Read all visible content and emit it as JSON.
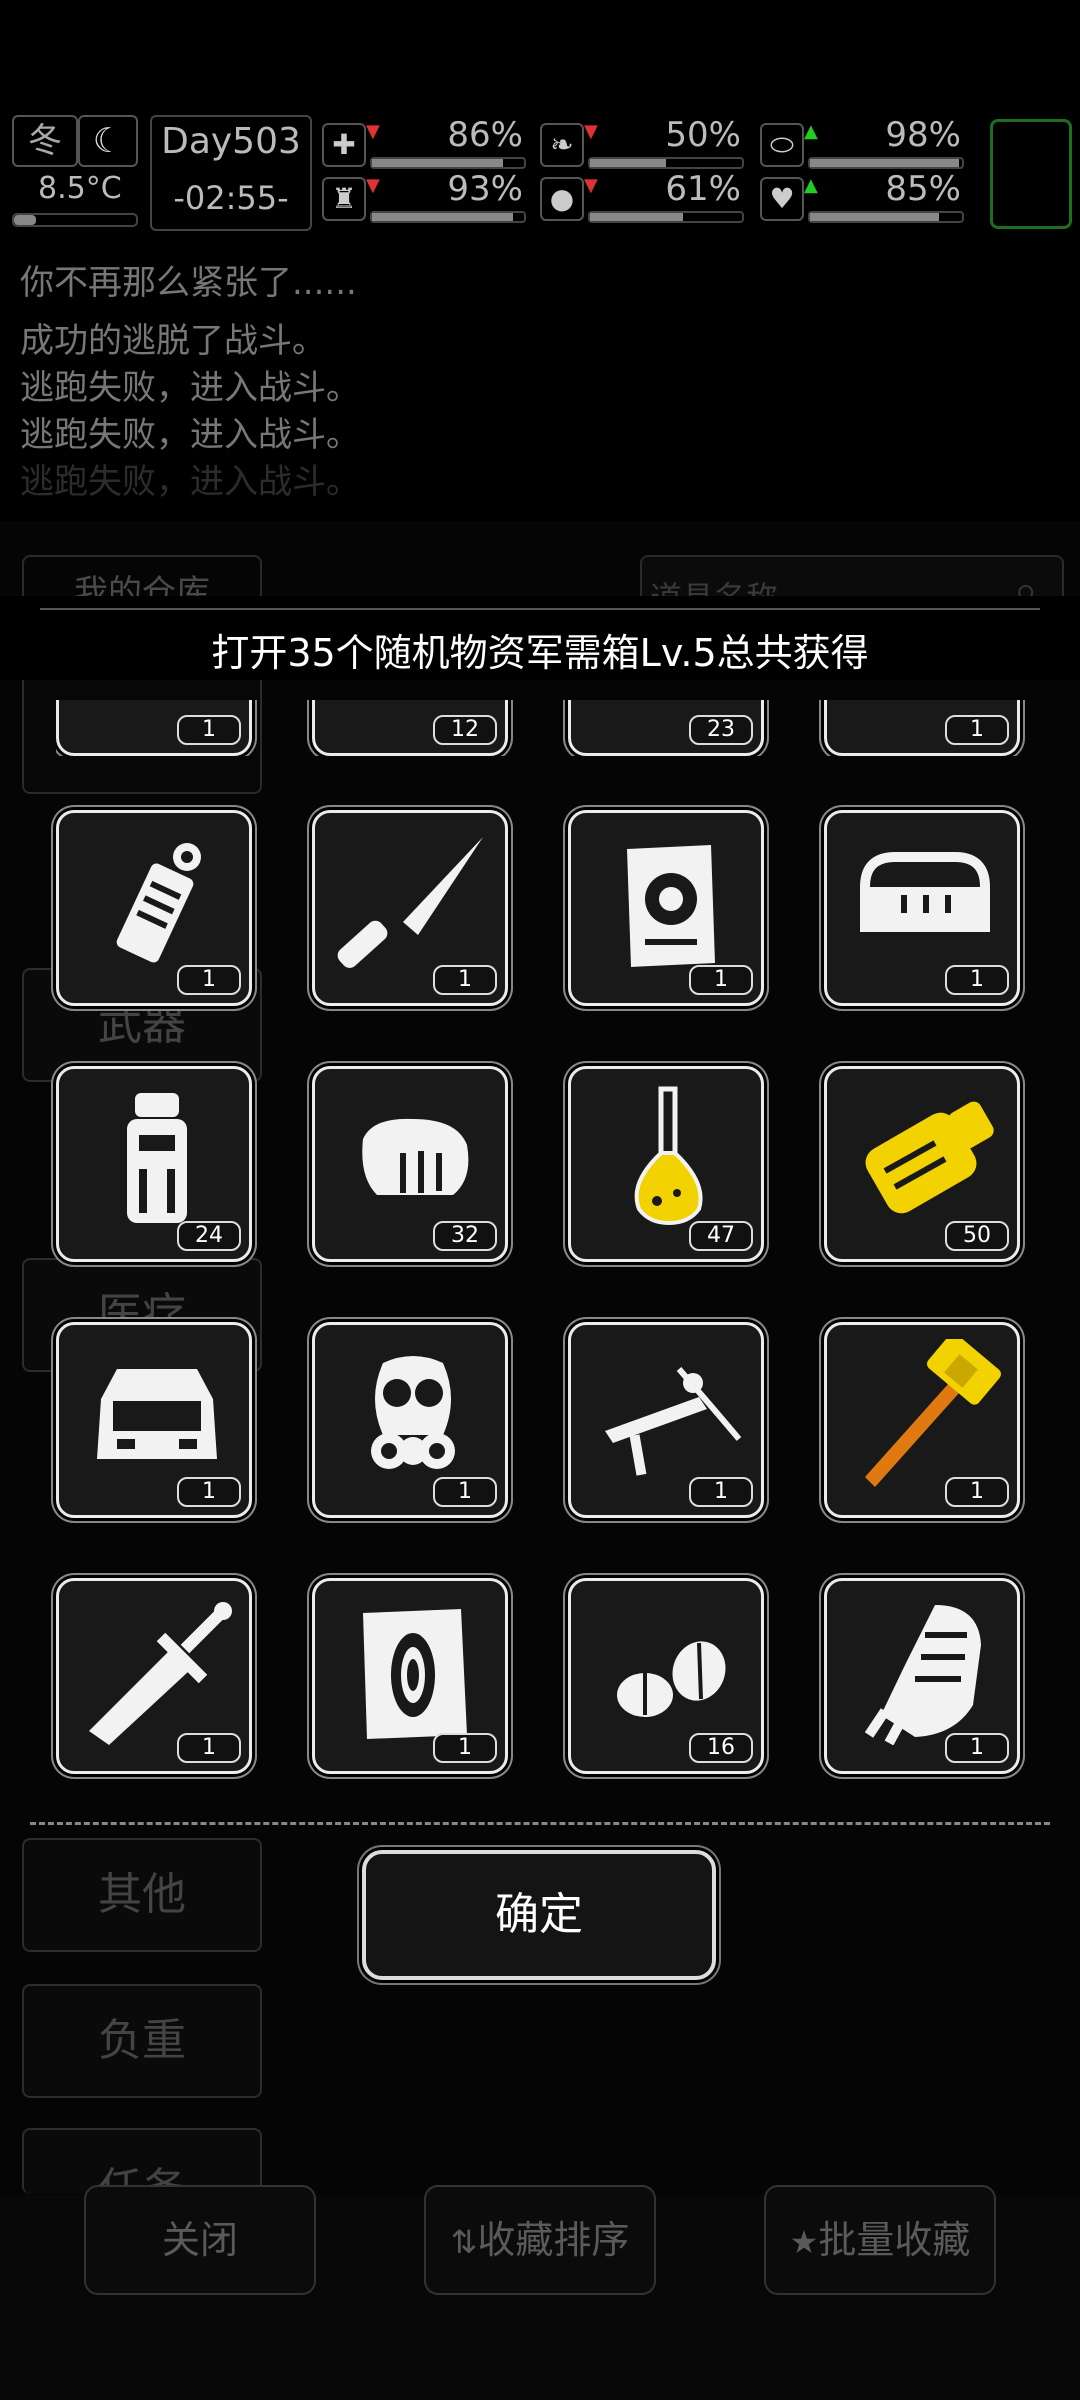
{
  "status": {
    "season": "冬",
    "temperature": "8.5°C",
    "day": "Day503",
    "clock": "-02:55-",
    "stats": [
      {
        "icon": "medkit-icon",
        "value": "86%",
        "fill": 0.86,
        "trend": "down"
      },
      {
        "icon": "stomach-icon",
        "value": "50%",
        "fill": 0.5,
        "trend": "down"
      },
      {
        "icon": "pill-icon",
        "value": "98%",
        "fill": 0.98,
        "trend": "up"
      },
      {
        "icon": "stamina-icon",
        "value": "93%",
        "fill": 0.93,
        "trend": "down"
      },
      {
        "icon": "water-drop-icon",
        "value": "61%",
        "fill": 0.61,
        "trend": "down"
      },
      {
        "icon": "heart-icon",
        "value": "85%",
        "fill": 0.85,
        "trend": "up"
      }
    ]
  },
  "log": [
    "你不再那么紧张了......",
    "成功的逃脱了战斗。",
    "逃跑失败，进入战斗。",
    "逃跑失败，进入战斗。",
    "逃跑失败，进入战斗。"
  ],
  "warehouse": {
    "title": "我的仓库",
    "search_placeholder": "道具名称",
    "tabs": [
      "武器",
      "医疗",
      "其他",
      "负重",
      "任务"
    ],
    "bottom_buttons": [
      "关闭",
      "收藏排序",
      "批量收藏"
    ]
  },
  "dialog": {
    "title": "打开35个随机物资军需箱Lv.5总共获得",
    "partial_counts": [
      "1",
      "12",
      "23",
      "1"
    ],
    "items": [
      {
        "name": "grenade-icon",
        "count": "1"
      },
      {
        "name": "knife-icon",
        "count": "1"
      },
      {
        "name": "blueprint-icon",
        "count": "1"
      },
      {
        "name": "bumper-icon",
        "count": "1"
      },
      {
        "name": "bottle-icon",
        "count": "24"
      },
      {
        "name": "meat-icon",
        "count": "32"
      },
      {
        "name": "flask-icon",
        "count": "47"
      },
      {
        "name": "gold-part-icon",
        "count": "50"
      },
      {
        "name": "car-trunk-icon",
        "count": "1"
      },
      {
        "name": "gas-mask-icon",
        "count": "1"
      },
      {
        "name": "crossbow-icon",
        "count": "1"
      },
      {
        "name": "hammer-icon",
        "count": "1"
      },
      {
        "name": "sword-icon",
        "count": "1"
      },
      {
        "name": "tire-blueprint-icon",
        "count": "1"
      },
      {
        "name": "seeds-icon",
        "count": "16"
      },
      {
        "name": "gauntlet-icon",
        "count": "1"
      }
    ],
    "confirm_label": "确定"
  },
  "colors": {
    "accent_green": "#1f6e1f",
    "gold": "#f2d200",
    "orange": "#e07a10"
  }
}
